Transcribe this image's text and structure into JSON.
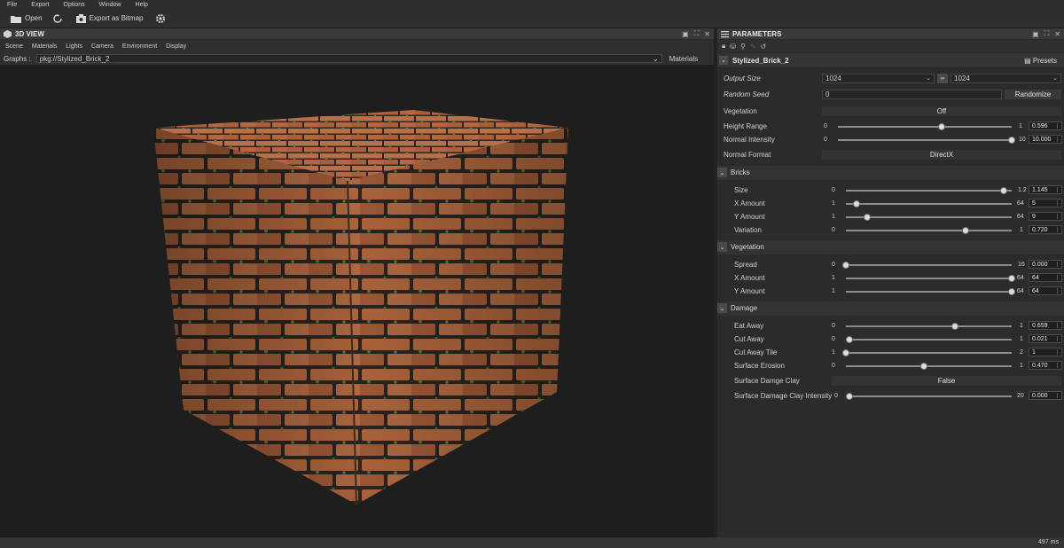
{
  "menu": [
    "File",
    "Export",
    "Options",
    "Window",
    "Help"
  ],
  "toolbar": {
    "open": "Open",
    "export_bitmap": "Export as Bitmap"
  },
  "view3d": {
    "title": "3D VIEW",
    "menu": [
      "Scene",
      "Materials",
      "Lights",
      "Camera",
      "Environment",
      "Display"
    ],
    "graphs_label": "Graphs :",
    "graph_value": "pkg://Stylized_Brick_2",
    "materials": "Materials"
  },
  "params": {
    "title": "PARAMETERS",
    "graph_name": "Stylized_Brick_2",
    "presets": "Presets",
    "output_size": {
      "label": "Output Size",
      "w": "1024",
      "h": "1024"
    },
    "random_seed": {
      "label": "Random Seed",
      "value": "0",
      "button": "Randomize"
    },
    "vegetation": {
      "label": "Vegetation",
      "value": "Off"
    },
    "height_range": {
      "label": "Height Range",
      "min": "0",
      "max": "1",
      "value": "0.596",
      "fraction": 0.596
    },
    "normal_intensity": {
      "label": "Normal Intensity",
      "min": "0",
      "max": "10",
      "value": "10.000",
      "fraction": 1.0
    },
    "normal_format": {
      "label": "Normal Format",
      "value": "DirectX"
    },
    "bricks": {
      "title": "Bricks",
      "size": {
        "label": "Size",
        "min": "0",
        "max": "1.2",
        "value": "1.145",
        "fraction": 0.954
      },
      "x_amount": {
        "label": "X Amount",
        "min": "1",
        "max": "64",
        "value": "5",
        "fraction": 0.063
      },
      "y_amount": {
        "label": "Y Amount",
        "min": "1",
        "max": "64",
        "value": "9",
        "fraction": 0.127
      },
      "variation": {
        "label": "Variation",
        "min": "0",
        "max": "1",
        "value": "0.720",
        "fraction": 0.72
      }
    },
    "veg_section": {
      "title": "Vegetation",
      "spread": {
        "label": "Spread",
        "min": "0",
        "max": "16",
        "value": "0.000",
        "fraction": 0.0
      },
      "x_amount": {
        "label": "X Amount",
        "min": "1",
        "max": "64",
        "value": "64",
        "fraction": 1.0
      },
      "y_amount": {
        "label": "Y Amount",
        "min": "1",
        "max": "64",
        "value": "64",
        "fraction": 1.0
      }
    },
    "damage": {
      "title": "Damage",
      "eat_away": {
        "label": "Eat Away",
        "min": "0",
        "max": "1",
        "value": "0.659",
        "fraction": 0.659
      },
      "cut_away": {
        "label": "Cut Away",
        "min": "0",
        "max": "1",
        "value": "0.021",
        "fraction": 0.021
      },
      "cut_away_tile": {
        "label": "Cut Away Tile",
        "min": "1",
        "max": "2",
        "value": "1",
        "fraction": 0.0
      },
      "surface_erosion": {
        "label": "Surface Erosion",
        "min": "0",
        "max": "1",
        "value": "0.470",
        "fraction": 0.47
      },
      "surface_damage_clay": {
        "label": "Surface Damge Clay",
        "value": "False"
      },
      "surface_damage_clay_intensity": {
        "label": "Surface Damage Clay Intensity",
        "min": "0",
        "max": "20",
        "value": "0.000",
        "fraction": 0.0
      }
    }
  },
  "status": {
    "time": "497 ms"
  },
  "colors": {
    "brick": "#b0653c",
    "mortar": "#2a2623",
    "moss": "#4f7a35",
    "panel": "#2b2b2b"
  }
}
